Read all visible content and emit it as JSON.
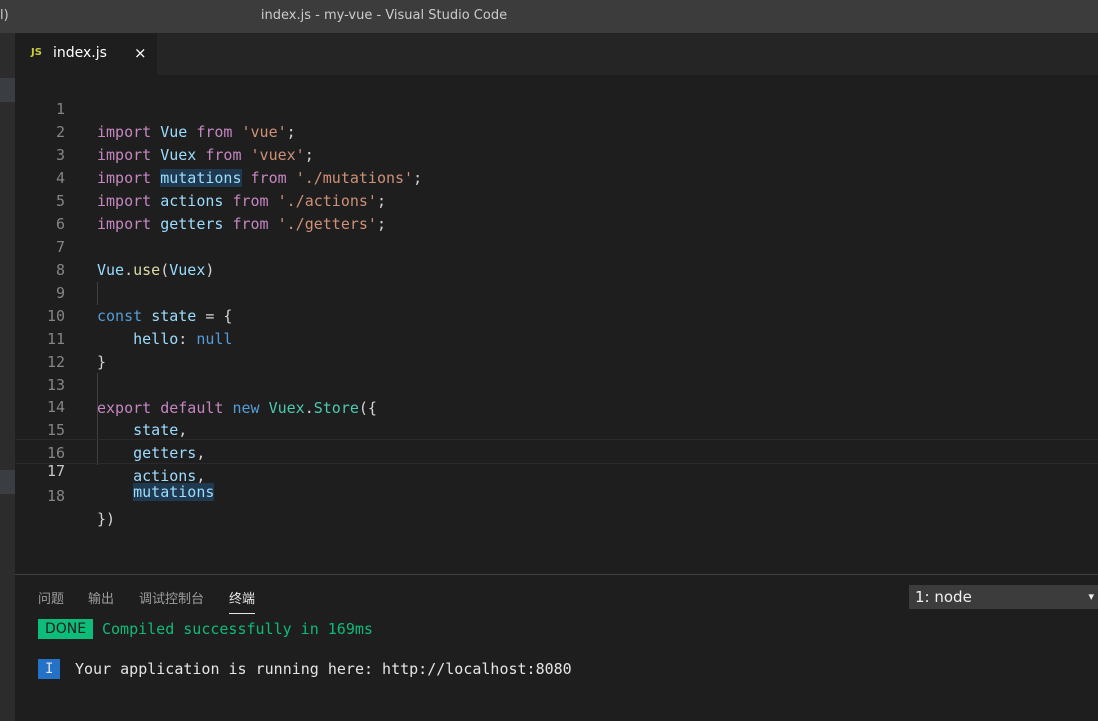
{
  "window": {
    "left_glyph": "l)",
    "title": "index.js - my-vue - Visual Studio Code"
  },
  "tab": {
    "icon_text": "JS",
    "label": "index.js",
    "close_glyph": "×"
  },
  "line_numbers": [
    "1",
    "2",
    "3",
    "4",
    "5",
    "6",
    "7",
    "8",
    "9",
    "10",
    "11",
    "12",
    "13",
    "14",
    "15",
    "16",
    "17",
    "18"
  ],
  "panel": {
    "tabs": [
      "问题",
      "输出",
      "调试控制台",
      "终端"
    ],
    "active_tab": "终端",
    "terminal_select": "1: node",
    "terminal_caret": "▾",
    "done_badge": "DONE",
    "done_message": "Compiled successfully in 169ms",
    "info_badge": "I",
    "info_message": "Your application is running here: http://localhost:8080"
  },
  "colors": {
    "keyword": "#c586c0",
    "storage": "#569cd6",
    "string": "#ce9178",
    "variable": "#9cdcfe",
    "class": "#4ec9b0",
    "function": "#dcdcaa",
    "done_green": "#0dbc79",
    "info_blue": "#2472c8"
  }
}
